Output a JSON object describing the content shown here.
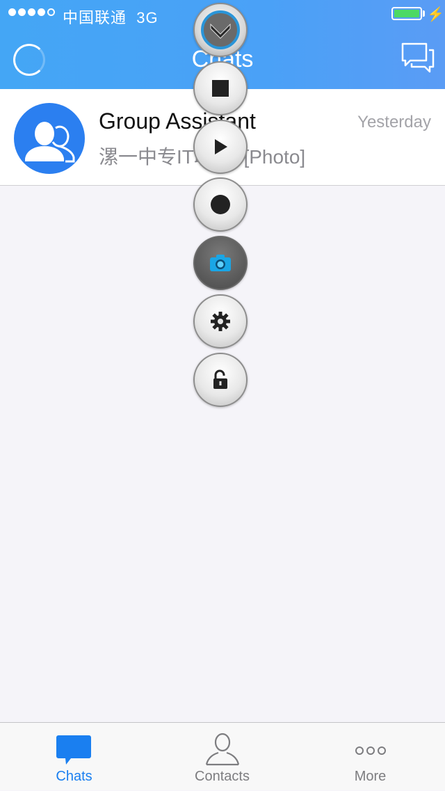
{
  "status_bar": {
    "carrier": "中国联通",
    "network": "3G"
  },
  "header": {
    "title": "Chats"
  },
  "chat_list": [
    {
      "name": "Group Assistant",
      "time": "Yesterday",
      "preview": "漯一中专IT联盟: [Photo]"
    }
  ],
  "tabbar": {
    "tabs": [
      {
        "label": "Chats",
        "active": true
      },
      {
        "label": "Contacts",
        "active": false
      },
      {
        "label": "More",
        "active": false
      }
    ]
  },
  "colors": {
    "header": "#4aa1f7",
    "accent": "#1a7ff0",
    "avatar": "#2b7ff0",
    "battery": "#4cd964"
  },
  "assistive_menu": [
    "collapse-icon",
    "stop-icon",
    "play-icon",
    "record-icon",
    "camera-icon",
    "gear-icon",
    "unlock-icon"
  ]
}
